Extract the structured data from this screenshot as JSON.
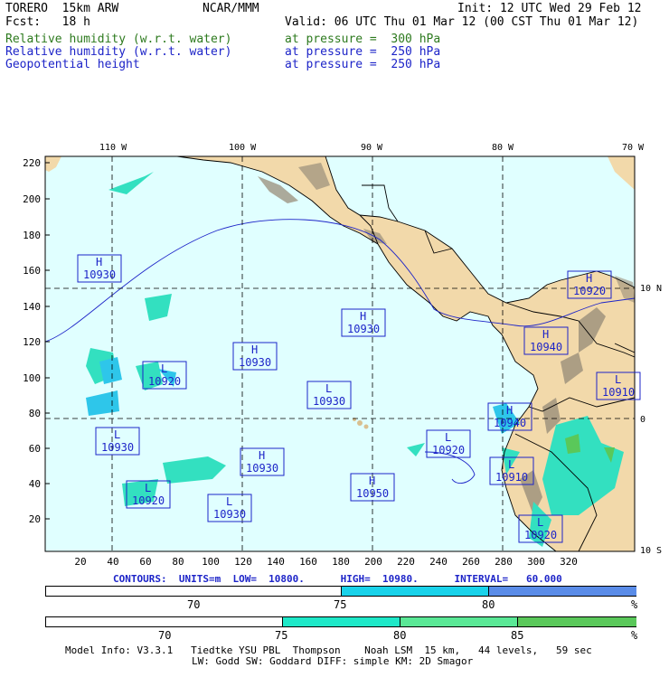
{
  "header": {
    "model": "TORERO  15km ARW",
    "center": "NCAR/MMM",
    "init": "Init: 12 UTC Wed 29 Feb 12",
    "fcst": "Fcst:   18 h",
    "valid": "Valid: 06 UTC Thu 01 Mar 12 (00 CST Thu 01 Mar 12)",
    "fields": [
      {
        "name": "Relative humidity (w.r.t. water)",
        "level": "at pressure =  300 hPa",
        "color": "#2d7a1e"
      },
      {
        "name": "Relative humidity (w.r.t. water)",
        "level": "at pressure =  250 hPa",
        "color": "#1d24c8"
      },
      {
        "name": "Geopotential height",
        "level": "at pressure =  250 hPa",
        "color": "#1d24c8"
      }
    ]
  },
  "map": {
    "lon_labels": [
      "110 W",
      "100 W",
      "90 W",
      "80 W",
      "70 W"
    ],
    "lat_labels": [
      "10 N",
      "0",
      "10 S"
    ],
    "y_ticks": [
      "220",
      "200",
      "180",
      "160",
      "140",
      "120",
      "100",
      "80",
      "60",
      "40",
      "20"
    ],
    "x_ticks": [
      "20",
      "40",
      "60",
      "80",
      "100",
      "120",
      "140",
      "160",
      "180",
      "200",
      "220",
      "240",
      "260",
      "280",
      "300",
      "320"
    ],
    "centers": [
      {
        "type": "H",
        "value": "10930"
      },
      {
        "type": "H",
        "value": "10920"
      },
      {
        "type": "H",
        "value": "10930"
      },
      {
        "type": "H",
        "value": "10940"
      },
      {
        "type": "L",
        "value": "10920"
      },
      {
        "type": "H",
        "value": "10930"
      },
      {
        "type": "L",
        "value": "10930"
      },
      {
        "type": "L",
        "value": "10910"
      },
      {
        "type": "L",
        "value": "10930"
      },
      {
        "type": "L",
        "value": "10920"
      },
      {
        "type": "H",
        "value": "10930"
      },
      {
        "type": "H",
        "value": "10940"
      },
      {
        "type": "L",
        "value": "10920"
      },
      {
        "type": "L",
        "value": "10930"
      },
      {
        "type": "H",
        "value": "10950"
      },
      {
        "type": "L",
        "value": "10920"
      },
      {
        "type": "L",
        "value": "10910"
      }
    ]
  },
  "contours_line": "CONTOURS:  UNITS=m  LOW=  10800.      HIGH=  10980.      INTERVAL=   60.000",
  "colorbar_250": {
    "labels": [
      "70",
      "75",
      "80",
      "%"
    ],
    "colors": [
      "#ffffff",
      "#19d2ea",
      "#5a8ce8"
    ]
  },
  "colorbar_300": {
    "labels": [
      "70",
      "75",
      "80",
      "85",
      "%"
    ],
    "colors": [
      "#ffffff",
      "#1ee8c8",
      "#5ae896",
      "#5ac85a"
    ]
  },
  "footer": {
    "line1": "Model Info: V3.3.1   Tiedtke YSU PBL  Thompson    Noah LSM  15 km,   44 levels,   59 sec",
    "line2": "LW: Godd SW: Goddard DIFF: simple KM: 2D Smagor"
  }
}
